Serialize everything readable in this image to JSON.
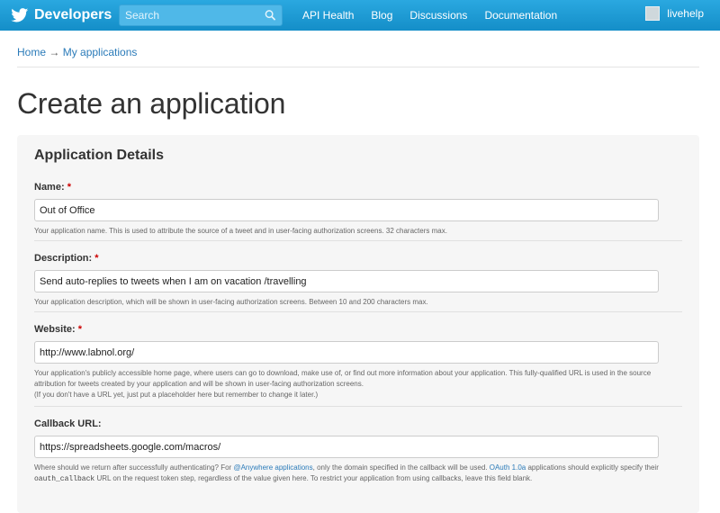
{
  "topbar": {
    "brand": "Developers",
    "search_placeholder": "Search",
    "nav": [
      "API Health",
      "Blog",
      "Discussions",
      "Documentation"
    ],
    "user": "livehelp",
    "color": "#1a9bd7"
  },
  "breadcrumb": {
    "home": "Home",
    "arrow": "→",
    "current": "My applications"
  },
  "page_title": "Create an application",
  "panel": {
    "title": "Application Details",
    "fields": {
      "name": {
        "label": "Name:",
        "value": "Out of Office",
        "help": "Your application name. This is used to attribute the source of a tweet and in user-facing authorization screens. 32 characters max."
      },
      "description": {
        "label": "Description:",
        "value": "Send auto-replies to tweets when I am on vacation /travelling",
        "help": "Your application description, which will be shown in user-facing authorization screens. Between 10 and 200 characters max."
      },
      "website": {
        "label": "Website:",
        "value": "http://www.labnol.org/",
        "help_line1": "Your application's publicly accessible home page, where users can go to download, make use of, or find out more information about your application. This fully-qualified URL is used in the source attribution for tweets created by your application and will be shown in user-facing authorization screens.",
        "help_line2": "(If you don't have a URL yet, just put a placeholder here but remember to change it later.)"
      },
      "callback": {
        "label": "Callback URL:",
        "value": "https://spreadsheets.google.com/macros/",
        "help_a": "Where should we return after successfully authenticating? For",
        "help_link1": "@Anywhere applications",
        "help_b": ", only the domain specified in the callback will be used.",
        "help_link2": "OAuth 1.0a",
        "help_c": "applications should explicitly specify their",
        "help_code": "oauth_callback",
        "help_d": "URL on the request token step, regardless of the value given here. To restrict your application from using callbacks, leave this field blank."
      }
    },
    "required_mark": "*"
  }
}
